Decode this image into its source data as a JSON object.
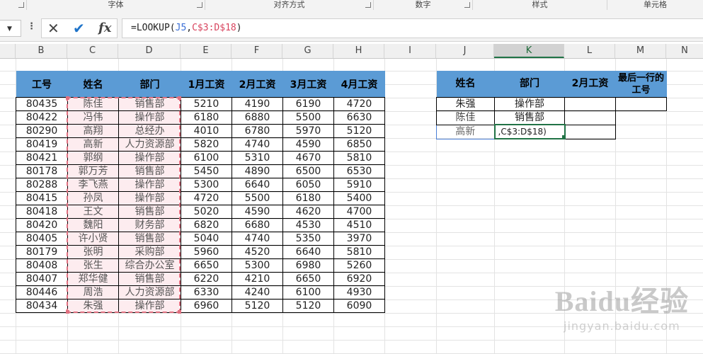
{
  "ribbon": {
    "groups": [
      {
        "label": ""
      },
      {
        "label": "字体"
      },
      {
        "label": "对齐方式"
      },
      {
        "label": "数字"
      },
      {
        "label": "样式"
      },
      {
        "label": "单元格"
      }
    ]
  },
  "formula_bar": {
    "cancel_icon": "close-icon",
    "enter_icon": "check-icon",
    "fx_label": "fx",
    "formula_prefix": "=LOOKUP(",
    "formula_ref1": "J5",
    "formula_sep": ",",
    "formula_ref2": "C$3:D$18",
    "formula_suffix": ")"
  },
  "columns": [
    "B",
    "C",
    "D",
    "E",
    "F",
    "G",
    "H",
    "I",
    "J",
    "K",
    "L",
    "M",
    "N"
  ],
  "salary_table": {
    "headers": [
      "工号",
      "姓名",
      "部门",
      "1月工资",
      "2月工资",
      "3月工资",
      "4月工资"
    ],
    "rows": [
      [
        "80435",
        "陈佳",
        "销售部",
        "5210",
        "4190",
        "6190",
        "4720"
      ],
      [
        "80422",
        "冯伟",
        "操作部",
        "6180",
        "6880",
        "5500",
        "6630"
      ],
      [
        "80290",
        "高翔",
        "总经办",
        "4010",
        "6780",
        "5970",
        "5120"
      ],
      [
        "80419",
        "高新",
        "人力资源部",
        "5820",
        "4740",
        "4590",
        "6850"
      ],
      [
        "80421",
        "郭纲",
        "操作部",
        "6100",
        "5310",
        "4670",
        "5810"
      ],
      [
        "80178",
        "郭万芳",
        "销售部",
        "5450",
        "4890",
        "6500",
        "6530"
      ],
      [
        "80288",
        "李飞燕",
        "操作部",
        "5300",
        "6640",
        "6050",
        "5910"
      ],
      [
        "80415",
        "孙凤",
        "操作部",
        "4720",
        "5500",
        "6180",
        "5400"
      ],
      [
        "80418",
        "王文",
        "销售部",
        "5020",
        "4590",
        "4620",
        "4700"
      ],
      [
        "80420",
        "魏阳",
        "财务部",
        "6820",
        "6680",
        "4530",
        "4510"
      ],
      [
        "80405",
        "许小贤",
        "销售部",
        "5040",
        "4740",
        "5350",
        "3970"
      ],
      [
        "80179",
        "张明",
        "采购部",
        "5960",
        "4520",
        "6640",
        "5810"
      ],
      [
        "80408",
        "张生",
        "综合办公室",
        "6650",
        "5300",
        "6980",
        "5260"
      ],
      [
        "80407",
        "郑华健",
        "销售部",
        "6220",
        "4210",
        "6650",
        "6920"
      ],
      [
        "80446",
        "周浩",
        "人力资源部",
        "6330",
        "4240",
        "6100",
        "4930"
      ],
      [
        "80434",
        "朱强",
        "操作部",
        "6960",
        "5120",
        "5120",
        "6090"
      ]
    ]
  },
  "lookup_table": {
    "headers": [
      "姓名",
      "部门",
      "2月工资",
      "最后一行的工号"
    ],
    "rows": [
      [
        "朱强",
        "操作部",
        "",
        ""
      ],
      [
        "陈佳",
        "销售部",
        "",
        ""
      ],
      [
        "高新",
        ",C$3:D$18)",
        "",
        ""
      ]
    ]
  },
  "watermark": {
    "logo": "Baidu经验",
    "url": "jingyan.baidu.com"
  }
}
